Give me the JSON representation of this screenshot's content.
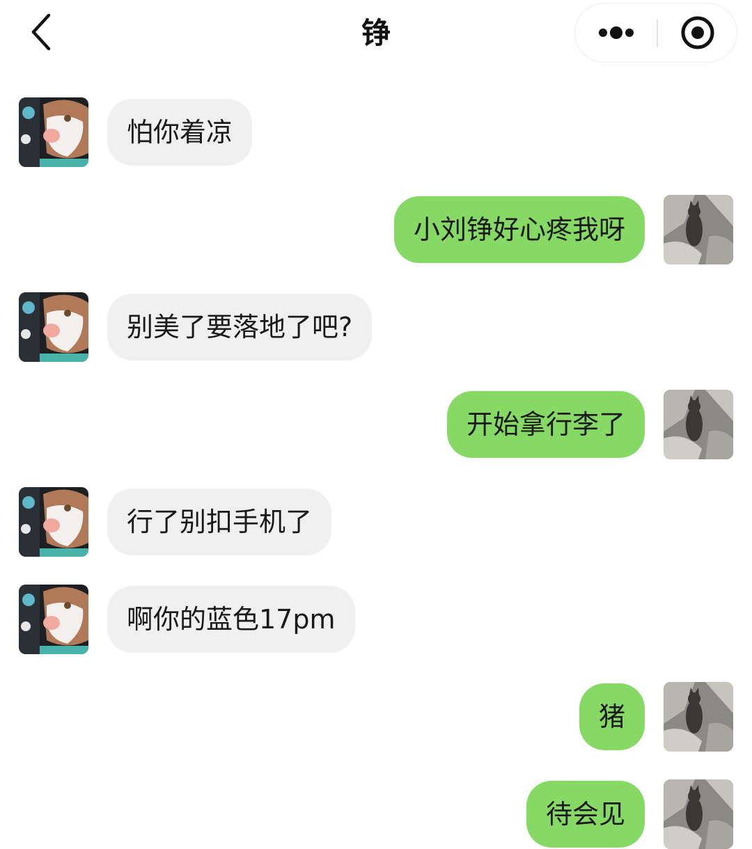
{
  "header": {
    "title": "铮",
    "back_icon": "chevron-left-icon",
    "more_icon": "more-dots-icon",
    "close_icon": "target-close-icon"
  },
  "colors": {
    "incoming_bubble": "#f0f0f0",
    "outgoing_bubble": "#86d965",
    "text": "#1a1a1a",
    "background": "#ffffff"
  },
  "messages": [
    {
      "side": "left",
      "text": "怕你着凉"
    },
    {
      "side": "right",
      "text": "小刘铮好心疼我呀"
    },
    {
      "side": "left",
      "text": "别美了要落地了吧?"
    },
    {
      "side": "right",
      "text": "开始拿行李了"
    },
    {
      "side": "left",
      "text": "行了别扣手机了"
    },
    {
      "side": "left",
      "text": "啊你的蓝色17pm"
    },
    {
      "side": "right",
      "text": "猪"
    },
    {
      "side": "right",
      "text": "待会见"
    }
  ]
}
